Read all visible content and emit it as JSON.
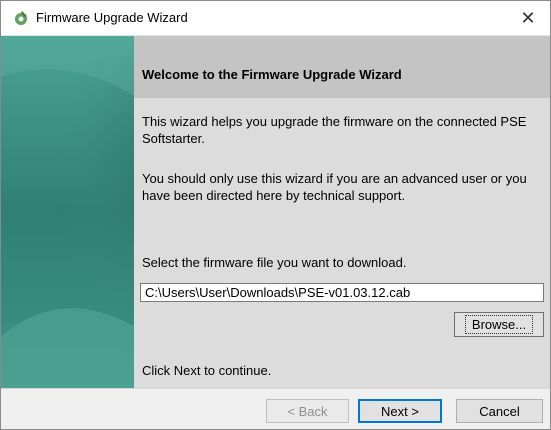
{
  "window": {
    "title": "Firmware Upgrade Wizard",
    "close_glyph": "✕",
    "icon": "wizard-gear-icon"
  },
  "header": {
    "title": "Welcome to the Firmware Upgrade Wizard"
  },
  "body": {
    "intro": "This wizard helps you upgrade the firmware on the connected PSE Softstarter.",
    "warning": "You should only use this wizard if you are an advanced user or you have been directed here by technical support.",
    "select_label": "Select the firmware file you want to download.",
    "file_path": "C:\\Users\\User\\Downloads\\PSE-v01.03.12.cab",
    "browse_label": "Browse...",
    "continue_text": "Click Next to continue."
  },
  "footer": {
    "back_label": "< Back",
    "next_label": "Next >",
    "cancel_label": "Cancel"
  },
  "colors": {
    "sidebar": "#3d8f84",
    "header": "#c4c4c4",
    "content": "#dcdcdc",
    "focus": "#0078d7"
  }
}
